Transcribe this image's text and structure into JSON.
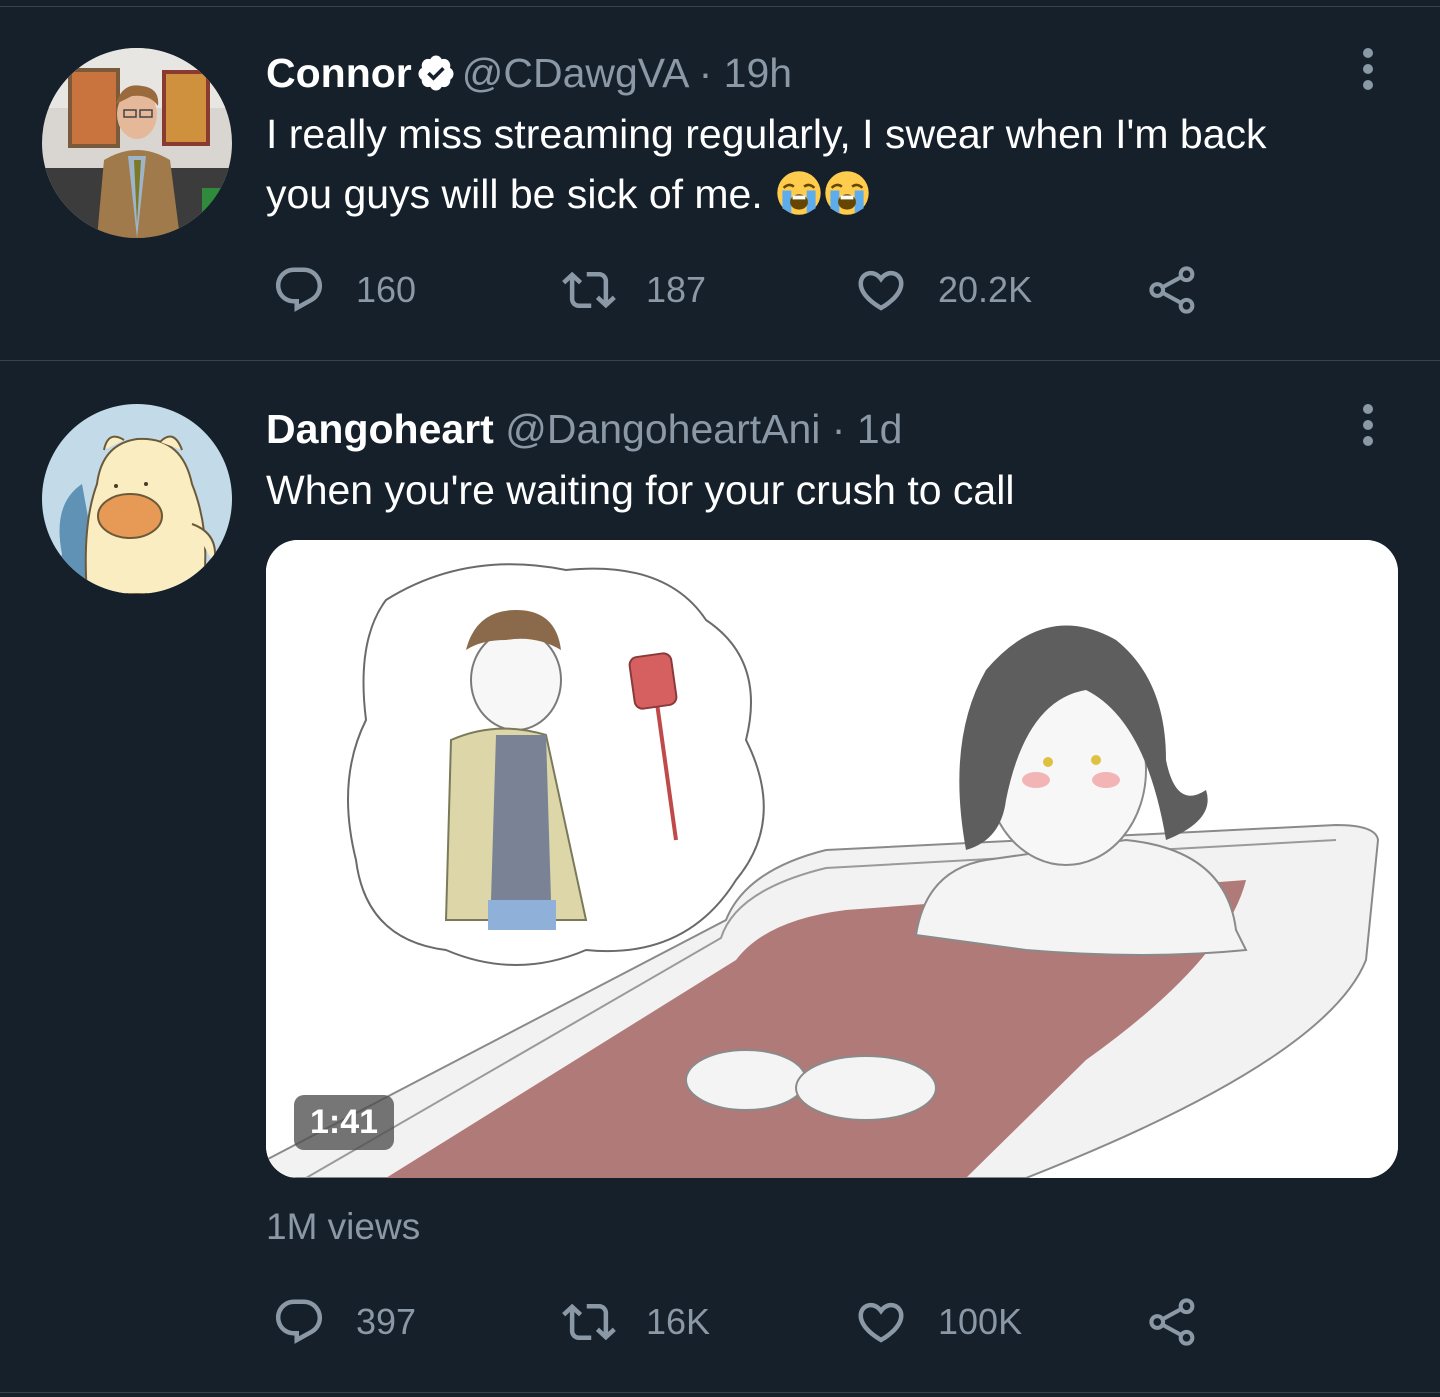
{
  "tweets": [
    {
      "name": "Connor",
      "verified": true,
      "handle": "@CDawgVA",
      "separator": "·",
      "time": "19h",
      "text_line1": "I really miss streaming regularly, I swear when I'm back",
      "text_line2": "you guys will be sick of me.",
      "emojis": [
        "loudly-crying-face",
        "loudly-crying-face"
      ],
      "replies": "160",
      "retweets": "187",
      "likes": "20.2K"
    },
    {
      "name": "Dangoheart",
      "verified": false,
      "handle": "@DangoheartAni",
      "separator": "·",
      "time": "1d",
      "text": "When you're waiting for your crush to call",
      "video_duration": "1:41",
      "views": "1M views",
      "replies": "397",
      "retweets": "16K",
      "likes": "100K"
    }
  ],
  "colors": {
    "background": "#15202b",
    "divider": "#38444d",
    "secondary_text": "#8b98a5",
    "verified_badge": "#ffffff"
  }
}
